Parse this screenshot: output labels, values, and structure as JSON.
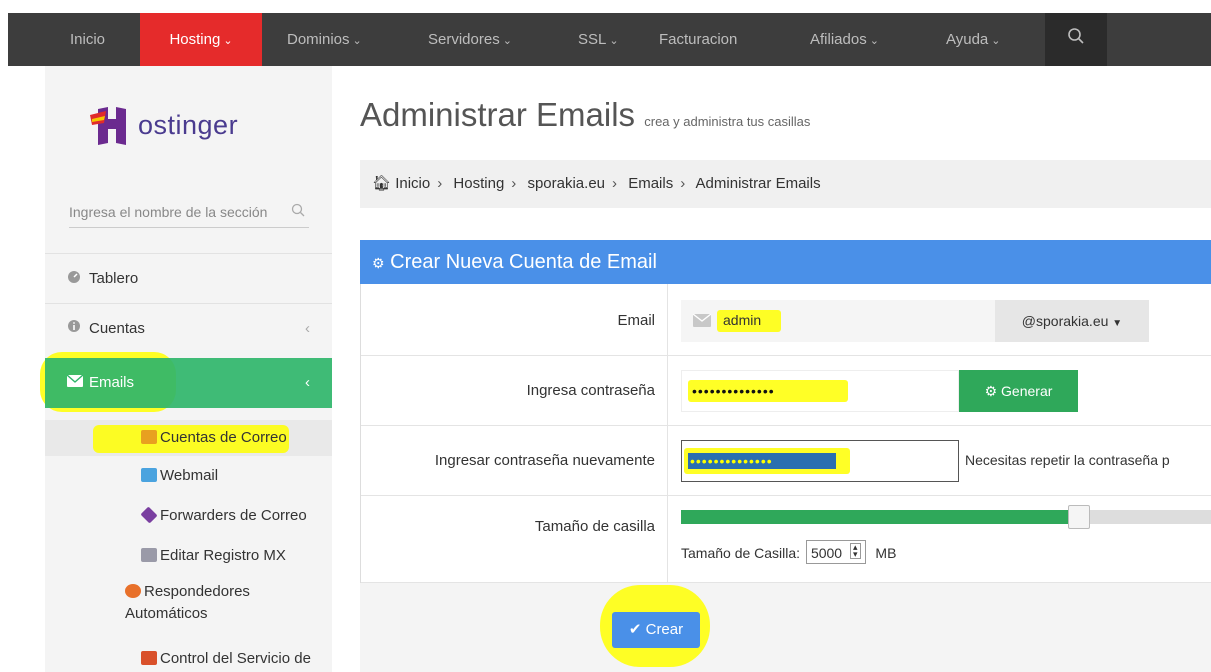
{
  "nav": {
    "items": [
      {
        "label": "Inicio",
        "chevron": ""
      },
      {
        "label": "Hosting",
        "chevron": "⌄"
      },
      {
        "label": "Dominios",
        "chevron": "⌄"
      },
      {
        "label": "Servidores",
        "chevron": "⌄"
      },
      {
        "label": "SSL",
        "chevron": "⌄"
      },
      {
        "label": "Facturacion",
        "chevron": ""
      },
      {
        "label": "Afiliados",
        "chevron": "⌄"
      },
      {
        "label": "Ayuda",
        "chevron": "⌄"
      }
    ],
    "active": "Hosting",
    "search_icon": "search-icon"
  },
  "sidebar": {
    "logo_text": "ostinger",
    "search_placeholder": "Ingresa el nombre de la sección",
    "menu": [
      {
        "label": "Tablero",
        "icon": "dashboard-icon"
      },
      {
        "label": "Cuentas",
        "icon": "info-icon",
        "chevron": "‹"
      },
      {
        "label": "Emails",
        "icon": "envelope-icon",
        "chevron": "‹"
      }
    ],
    "submenu": [
      {
        "label": "Cuentas de Correo",
        "icon": "mail-accounts-icon"
      },
      {
        "label": "Webmail",
        "icon": "webmail-icon"
      },
      {
        "label": "Forwarders de Correo",
        "icon": "forwarders-icon"
      },
      {
        "label": "Editar Registro MX",
        "icon": "mx-record-icon"
      },
      {
        "label": "Respondedores Automáticos",
        "icon": "autoresponder-icon"
      },
      {
        "label": "Control del Servicio de",
        "icon": "service-control-icon"
      }
    ]
  },
  "main": {
    "title": "Administrar Emails",
    "subtitle": "crea y administra tus casillas",
    "breadcrumb": [
      "Inicio",
      "Hosting",
      "sporakia.eu",
      "Emails",
      "Administrar Emails"
    ],
    "panel_title": "Crear Nueva Cuenta de Email",
    "form": {
      "email_label": "Email",
      "email_value": "admin",
      "domain": "@sporakia.eu",
      "password_label": "Ingresa contraseña",
      "password_mask": "••••••••••••••",
      "generate_label": "Generar",
      "password2_label": "Ingresar contraseña nuevamente",
      "password2_mask": "••••••••••••••",
      "password2_hint": "Necesitas repetir la contraseña p",
      "size_label": "Tamaño de casilla",
      "size_fraction": 0.75,
      "size_inline_label": "Tamaño de Casilla:",
      "size_value": "5000",
      "size_unit": "MB"
    },
    "submit_label": "Crear"
  },
  "colors": {
    "navbar": "#3d3d3d",
    "nav_active": "#e52b2b",
    "panel_header": "#4a90e8",
    "menu_active": "#2fb56a",
    "highlight": "#ffff00"
  }
}
